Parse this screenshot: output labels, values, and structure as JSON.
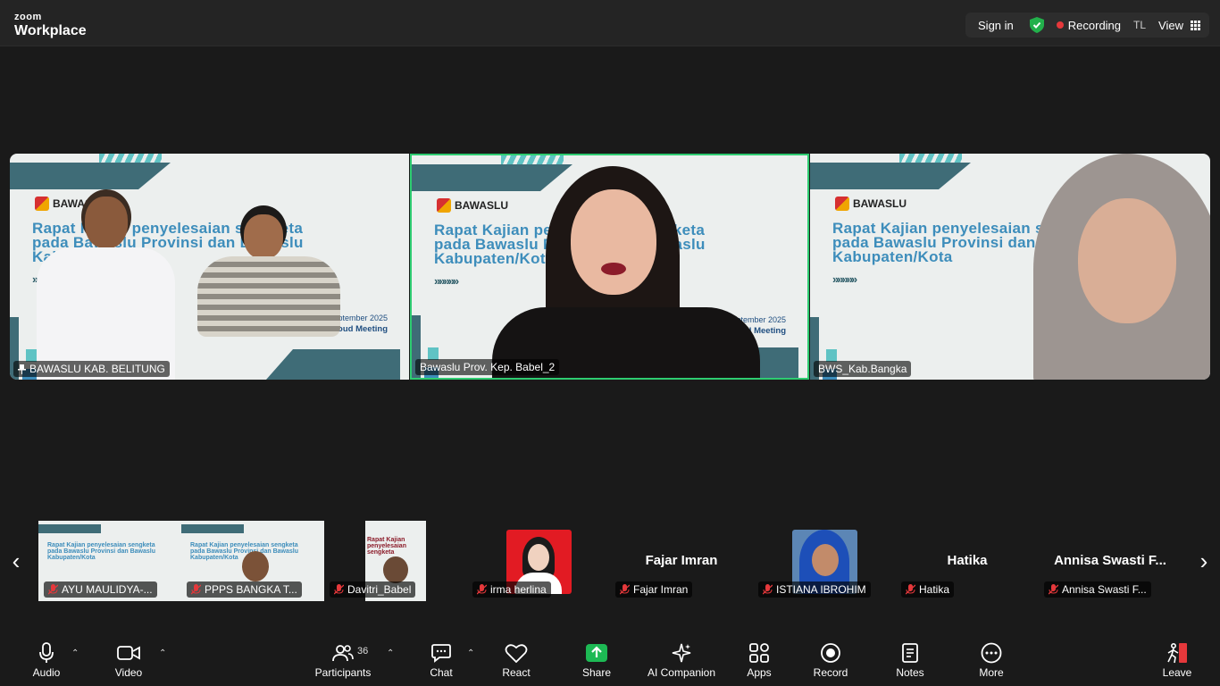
{
  "app": {
    "brand_small": "zoom",
    "brand_large": "Workplace"
  },
  "header": {
    "sign_in": "Sign in",
    "recording": "Recording",
    "initials": "TL",
    "view": "View"
  },
  "slide": {
    "logo_text": "BAWASLU",
    "title_line1": "Rapat Kajian penyelesaian sengketa",
    "title_line2": "pada Bawaslu Provinsi dan Bawaslu",
    "title_line3": "Kabupaten/Kota",
    "chevrons": "»»»»»",
    "date": "10 September 2025",
    "meeting": "Zoom Cloud Meeting"
  },
  "gallery": [
    {
      "name": "BAWASLU KAB. BELITUNG",
      "pinned": true
    },
    {
      "name": "Bawaslu Prov. Kep. Babel_2",
      "pinned": false
    },
    {
      "name": "BWS_Kab.Bangka",
      "pinned": false
    }
  ],
  "filmstrip": [
    {
      "name": "AYU MAULIDYA-...",
      "big": ""
    },
    {
      "name": "PPPS BANGKA T...",
      "big": ""
    },
    {
      "name": "Davitri_Babel",
      "big": ""
    },
    {
      "name": "irma herlina",
      "big": ""
    },
    {
      "name": "Fajar Imran",
      "big": "Fajar Imran"
    },
    {
      "name": "ISTIANA IBROHIM",
      "big": ""
    },
    {
      "name": "Hatika",
      "big": "Hatika"
    },
    {
      "name": "Annisa Swasti F...",
      "big": "Annisa Swasti F..."
    }
  ],
  "toolbar": {
    "audio": "Audio",
    "video": "Video",
    "participants": "Participants",
    "participant_count": "36",
    "chat": "Chat",
    "react": "React",
    "share": "Share",
    "ai_companion": "AI Companion",
    "apps": "Apps",
    "record": "Record",
    "notes": "Notes",
    "more": "More",
    "leave": "Leave"
  },
  "colors": {
    "accent_green": "#2ecc71",
    "share_green": "#1db954",
    "record_red": "#e5383b",
    "leave_red": "#e5383b"
  }
}
